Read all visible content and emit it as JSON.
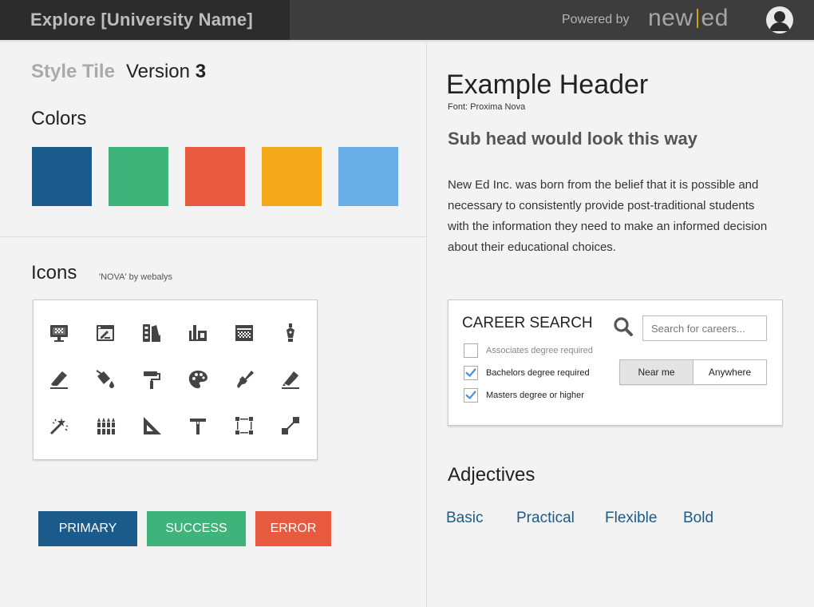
{
  "header": {
    "brand": "Explore [University Name]",
    "powered_by": "Powered by",
    "logo_left": "new",
    "logo_right": "ed"
  },
  "style_tile": {
    "label": "Style Tile",
    "version_label": "Version",
    "version_number": "3"
  },
  "colors": {
    "heading": "Colors",
    "swatches": [
      "#1b5b8c",
      "#3eb37a",
      "#e85a3f",
      "#f3a91a",
      "#6aaee8"
    ]
  },
  "icons": {
    "heading": "Icons",
    "credit": "'NOVA' by webalys",
    "names": [
      "monitor-icon",
      "browser-edit-icon",
      "swatch-palette-icon",
      "tools-box-icon",
      "calendar-grid-icon",
      "pen-nib-icon",
      "eraser-icon",
      "paint-bucket-icon",
      "paint-roller-icon",
      "palette-icon",
      "paint-brush-icon",
      "highlighter-icon",
      "magic-wand-icon",
      "crayons-icon",
      "set-square-icon",
      "hammer-icon",
      "select-frame-icon",
      "resize-handles-icon"
    ],
    "color": "#444444"
  },
  "buttons": {
    "primary": {
      "label": "PRIMARY",
      "color": "#1b5b8c"
    },
    "success": {
      "label": "SUCCESS",
      "color": "#3eb37a"
    },
    "error": {
      "label": "ERROR",
      "color": "#e85a3f"
    }
  },
  "typography": {
    "header": "Example Header",
    "font_note": "Font: Proxima Nova",
    "subhead": "Sub head would look this way",
    "body": "New Ed Inc. was born from the belief that  it is possible and necessary to consistently provide post-traditional students with the information they need to make an informed decision about their educational choices."
  },
  "career_search": {
    "title": "CAREER SEARCH",
    "search_placeholder": "Search for careers...",
    "options": [
      {
        "label": "Associates degree required",
        "checked": false
      },
      {
        "label": "Bachelors degree required",
        "checked": true
      },
      {
        "label": "Masters degree or higher",
        "checked": true
      }
    ],
    "location": {
      "near": "Near me",
      "anywhere": "Anywhere",
      "selected": "Near me"
    },
    "check_color": "#4a90d9"
  },
  "adjectives": {
    "heading": "Adjectives",
    "items": [
      "Basic",
      "Practical",
      "Flexible",
      "Bold"
    ],
    "color": "#1a5b8a"
  }
}
